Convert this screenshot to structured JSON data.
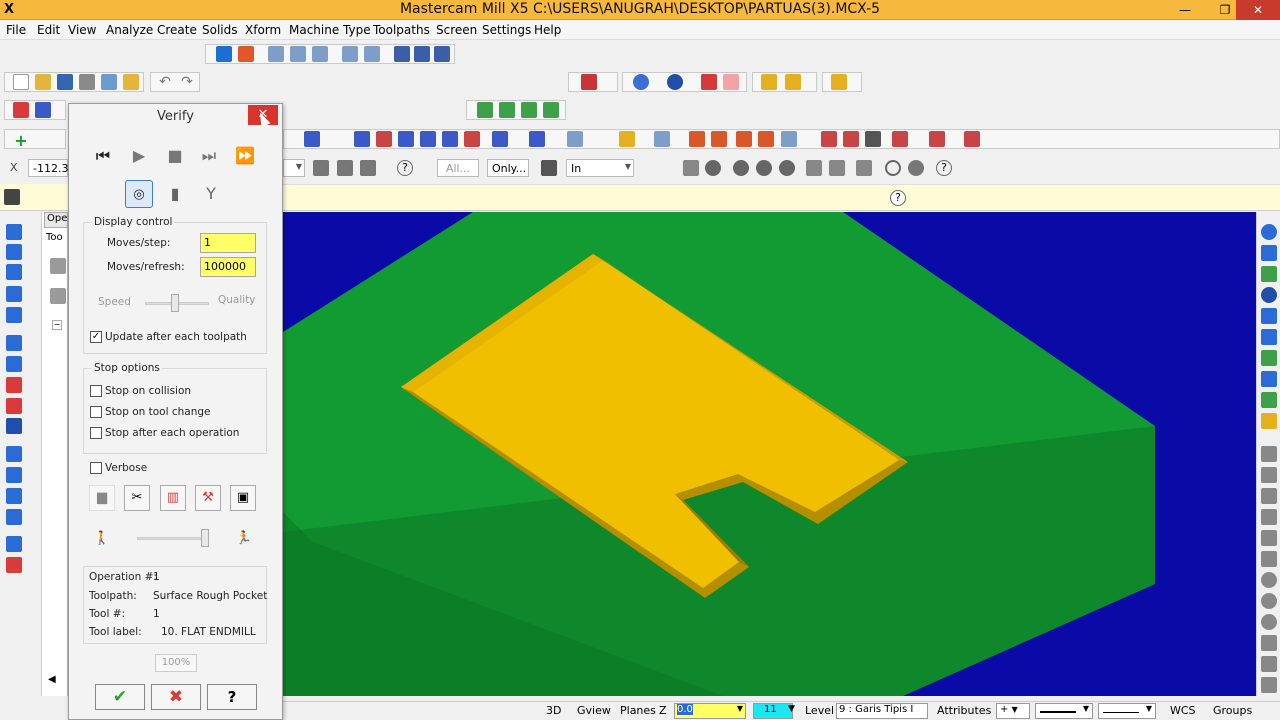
{
  "window": {
    "app_icon": "X",
    "title": "Mastercam Mill X5  C:\\USERS\\ANUGRAH\\DESKTOP\\PARTUAS(3).MCX-5",
    "minimize": "—",
    "restore": "❐",
    "close": "✕"
  },
  "menu": [
    "File",
    "Edit",
    "View",
    "Analyze",
    "Create",
    "Solids",
    "Xform",
    "Machine Type",
    "Toolpaths",
    "Screen",
    "Settings",
    "Help"
  ],
  "toolbar": {
    "coord_label": "X",
    "coord_value": "-112.39",
    "filter_all": "All...",
    "filter_only": "Only...",
    "selection_mode": "In"
  },
  "manager": {
    "tab_label": "Ope",
    "sub_label": "Too"
  },
  "verify": {
    "title": "Verify",
    "display_control": "Display control",
    "moves_step_label": "Moves/step:",
    "moves_step_value": "1",
    "moves_refresh_label": "Moves/refresh:",
    "moves_refresh_value": "100000",
    "speed_label": "Speed",
    "quality_label": "Quality",
    "update_after": "Update after each toolpath",
    "stop_options": "Stop options",
    "stop_collision": "Stop on collision",
    "stop_tool_change": "Stop on tool change",
    "stop_after_op": "Stop after each operation",
    "verbose": "Verbose",
    "operation_label": "Operation #:",
    "operation_value": "1",
    "toolpath_label": "Toolpath:",
    "toolpath_value": "Surface Rough Pocket",
    "tool_num_label": "Tool #:",
    "tool_num_value": "1",
    "tool_label_label": "Tool label:",
    "tool_label_value": "10. FLAT ENDMILL",
    "progress": "100%",
    "help": "?"
  },
  "status": {
    "view3d": "3D",
    "gview": "Gview",
    "planes": "Planes",
    "z_label": "Z",
    "z_value": "0.0",
    "color_value": "11",
    "level_label": "Level",
    "level_value": "9 : Garis Tipis I",
    "attributes": "Attributes",
    "wcs": "WCS",
    "groups": "Groups"
  },
  "colors": {
    "titlebar": "#f6b93d",
    "viewport_bg": "#0a0aa6",
    "stock": "#118f2f",
    "pocket": "#f0c000",
    "close_red": "#d9342b"
  }
}
